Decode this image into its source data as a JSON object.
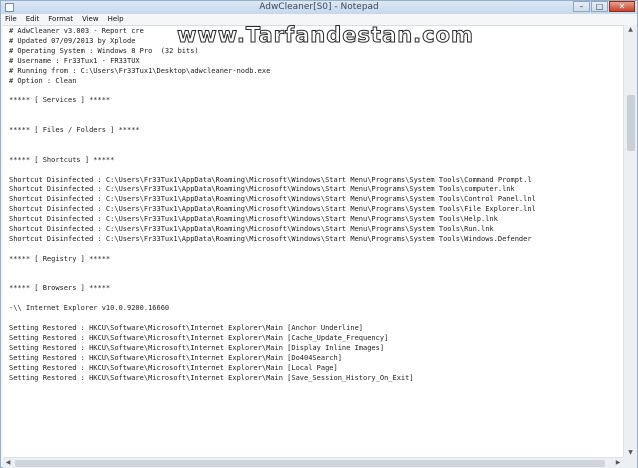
{
  "window": {
    "title": "AdwCleaner[S0] - Notepad",
    "controls": {
      "minimize": "–",
      "maximize": "□",
      "close": "✕"
    }
  },
  "menu": [
    "File",
    "Edit",
    "Format",
    "View",
    "Help"
  ],
  "watermark": "www.Tarfandestan.com",
  "scroll": {
    "up": "▲",
    "down": "▼",
    "left": "◀",
    "right": "▶"
  },
  "document": {
    "lines": [
      "# AdwCleaner v3.003 - Report cre",
      "# Updated 07/09/2013 by Xplode",
      "# Operating System : Windows 8 Pro  (32 bits)",
      "# Username : Fr33Tux1 - FR33TUX",
      "# Running from : C:\\Users\\Fr33Tux1\\Desktop\\adwcleaner-nodb.exe",
      "# Option : Clean",
      "",
      "***** [ Services ] *****",
      "",
      "",
      "***** [ Files / Folders ] *****",
      "",
      "",
      "***** [ Shortcuts ] *****",
      "",
      "Shortcut Disinfected : C:\\Users\\Fr33Tux1\\AppData\\Roaming\\Microsoft\\Windows\\Start Menu\\Programs\\System Tools\\Command Prompt.l",
      "Shortcut Disinfected : C:\\Users\\Fr33Tux1\\AppData\\Roaming\\Microsoft\\Windows\\Start Menu\\Programs\\System Tools\\computer.lnk",
      "Shortcut Disinfected : C:\\Users\\Fr33Tux1\\AppData\\Roaming\\Microsoft\\Windows\\Start Menu\\Programs\\System Tools\\Control Panel.lnl",
      "Shortcut Disinfected : C:\\Users\\Fr33Tux1\\AppData\\Roaming\\Microsoft\\Windows\\Start Menu\\Programs\\System Tools\\File Explorer.lnl",
      "Shortcut Disinfected : C:\\Users\\Fr33Tux1\\AppData\\Roaming\\Microsoft\\Windows\\Start Menu\\Programs\\System Tools\\Help.lnk",
      "Shortcut Disinfected : C:\\Users\\Fr33Tux1\\AppData\\Roaming\\Microsoft\\Windows\\Start Menu\\Programs\\System Tools\\Run.lnk",
      "Shortcut Disinfected : C:\\Users\\Fr33Tux1\\AppData\\Roaming\\Microsoft\\Windows\\Start Menu\\Programs\\System Tools\\Windows.Defender",
      "",
      "***** [ Registry ] *****",
      "",
      "",
      "***** [ Browsers ] *****",
      "",
      "-\\\\ Internet Explorer v10.0.9200.16660",
      "",
      "Setting Restored : HKCU\\Software\\Microsoft\\Internet Explorer\\Main [Anchor Underline]",
      "Setting Restored : HKCU\\Software\\Microsoft\\Internet Explorer\\Main [Cache_Update_Frequency]",
      "Setting Restored : HKCU\\Software\\Microsoft\\Internet Explorer\\Main [Display Inline Images]",
      "Setting Restored : HKCU\\Software\\Microsoft\\Internet Explorer\\Main [Do404Search]",
      "Setting Restored : HKCU\\Software\\Microsoft\\Internet Explorer\\Main [Local Page]",
      "Setting Restored : HKCU\\Software\\Microsoft\\Internet Explorer\\Main [Save_Session_History_On_Exit]"
    ]
  }
}
